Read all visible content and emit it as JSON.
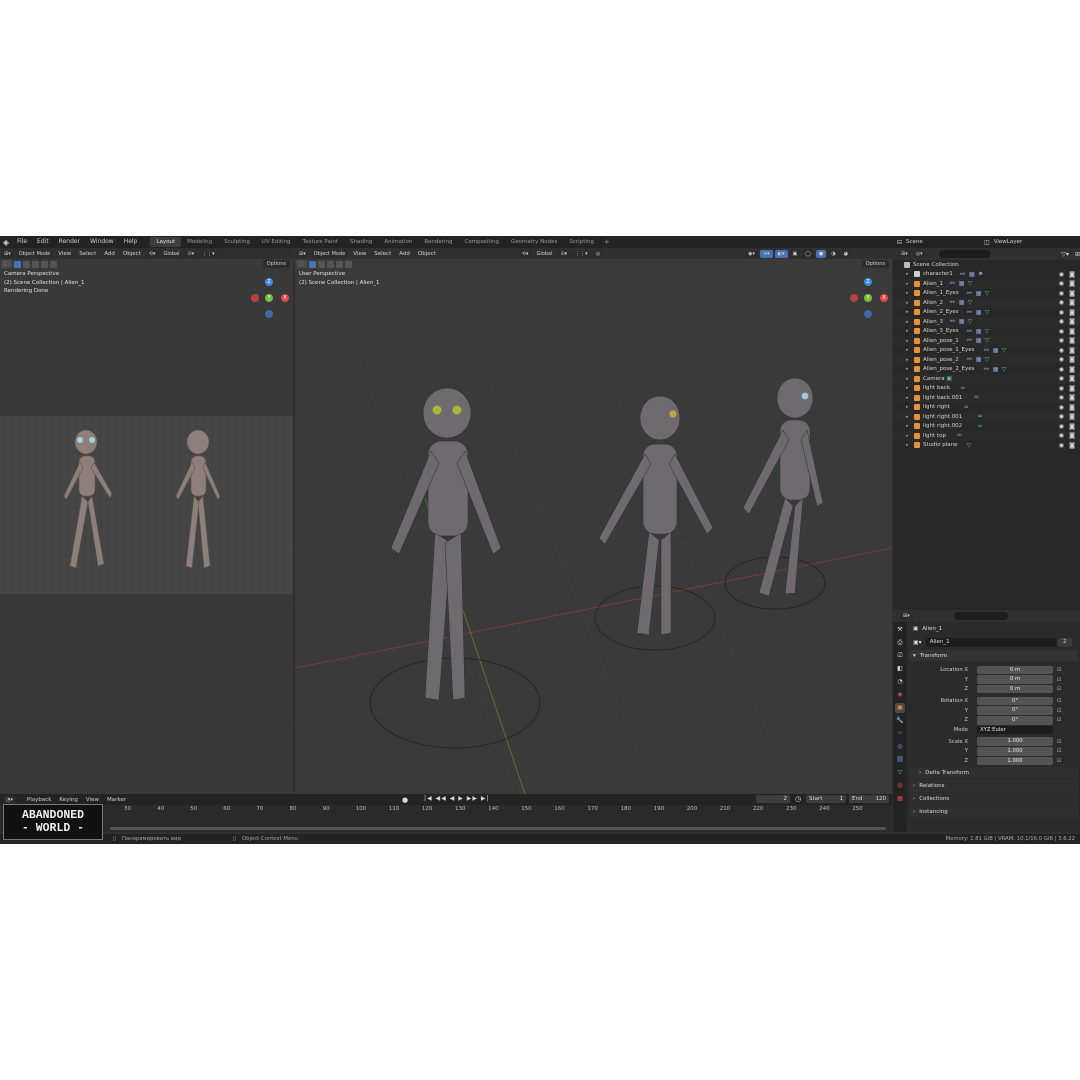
{
  "app": {
    "menu": [
      "File",
      "Edit",
      "Render",
      "Window",
      "Help"
    ],
    "workspaces": [
      "Layout",
      "Modeling",
      "Sculpting",
      "UV Editing",
      "Texture Paint",
      "Shading",
      "Animation",
      "Rendering",
      "Compositing",
      "Geometry Nodes",
      "Scripting"
    ],
    "active_workspace": "Layout",
    "add_tab": "+",
    "scene_label": "Scene",
    "view_layer_label": "ViewLayer"
  },
  "viewport_left": {
    "mode": "Object Mode",
    "menus": [
      "View",
      "Select",
      "Add",
      "Object"
    ],
    "orientation": "Global",
    "options": "Options",
    "info": [
      "Camera Perspective",
      "(2) Scene Collection | Alien_1",
      "Rendering Done"
    ]
  },
  "viewport_main": {
    "mode": "Object Mode",
    "menus": [
      "View",
      "Select",
      "Add",
      "Object"
    ],
    "orientation": "Global",
    "options": "Options",
    "info": [
      "User Perspective",
      "(2) Scene Collection | Alien_1"
    ]
  },
  "gizmo": {
    "x_label": "X",
    "y_label": "Y",
    "z_label": "Z"
  },
  "outliner": {
    "root": "Scene Collection",
    "items": [
      {
        "name": "character1",
        "icon": "collection-icon",
        "color": "#cfcfcf"
      },
      {
        "name": "Alien_1",
        "icon": "armature-icon",
        "color": "#e8913a"
      },
      {
        "name": "Alien_1_Eyes",
        "icon": "armature-icon",
        "color": "#e8913a"
      },
      {
        "name": "Alien_2",
        "icon": "armature-icon",
        "color": "#e8913a"
      },
      {
        "name": "Alien_2_Eyes",
        "icon": "armature-icon",
        "color": "#e8913a"
      },
      {
        "name": "Alien_3",
        "icon": "armature-icon",
        "color": "#e8913a"
      },
      {
        "name": "Alien_3_Eyes",
        "icon": "armature-icon",
        "color": "#e8913a"
      },
      {
        "name": "Alien_pose_1",
        "icon": "armature-icon",
        "color": "#e8913a"
      },
      {
        "name": "Alien_pose_1_Eyes",
        "icon": "armature-icon",
        "color": "#e8913a"
      },
      {
        "name": "Alien_pose_2",
        "icon": "armature-icon",
        "color": "#e8913a"
      },
      {
        "name": "Alien_pose_2_Eyes",
        "icon": "armature-icon",
        "color": "#e8913a"
      },
      {
        "name": "Camera",
        "icon": "camera-icon",
        "color": "#e8913a"
      },
      {
        "name": "light back",
        "icon": "light-icon",
        "color": "#e8913a"
      },
      {
        "name": "light back.001",
        "icon": "light-icon",
        "color": "#e8913a"
      },
      {
        "name": "light right",
        "icon": "light-icon",
        "color": "#e8913a"
      },
      {
        "name": "light right.001",
        "icon": "light-icon",
        "color": "#e8913a"
      },
      {
        "name": "light right.002",
        "icon": "light-icon",
        "color": "#e8913a"
      },
      {
        "name": "light top",
        "icon": "light-icon",
        "color": "#e8913a"
      },
      {
        "name": "Studio plane",
        "icon": "mesh-icon",
        "color": "#e8913a"
      }
    ]
  },
  "properties": {
    "object_name": "Alien_1",
    "data_name": "Alien_1",
    "users": "2",
    "transform_label": "Transform",
    "location": {
      "label": "Location X",
      "x": "0 m",
      "y": "0 m",
      "z": "0 m"
    },
    "rotation": {
      "label": "Rotation X",
      "x": "0°",
      "y": "0°",
      "z": "0°"
    },
    "mode_label": "Mode",
    "mode_value": "XYZ Euler",
    "scale": {
      "label": "Scale X",
      "x": "1.000",
      "y": "1.000",
      "z": "1.000"
    },
    "axis_y": "Y",
    "axis_z": "Z",
    "delta_transform": "Delta Transform",
    "relations": "Relations",
    "collections": "Collections",
    "instancing": "Instancing"
  },
  "timeline": {
    "menus": [
      "Playback",
      "Keying",
      "View",
      "Marker"
    ],
    "current_frame": "2",
    "start_label": "Start",
    "start": "1",
    "end_label": "End",
    "end": "120",
    "ticks": [
      "30",
      "40",
      "50",
      "60",
      "70",
      "80",
      "90",
      "100",
      "110",
      "120",
      "130",
      "140",
      "150",
      "160",
      "170",
      "180",
      "190",
      "200",
      "210",
      "220",
      "230",
      "240",
      "250"
    ]
  },
  "status": {
    "left": "Панорамировать вид",
    "middle": "Object Context Menu",
    "memory": "Memory: 1.81 GiB | VRAM: 10.1/16.0 GiB | 3.6.22"
  },
  "watermark": {
    "line1": "ABANDONED",
    "line2": "WORLD"
  },
  "colors": {
    "accent": "#4772b3",
    "orange": "#e8913a",
    "green": "#5fbf87",
    "x_axis": "#e04848",
    "y_axis": "#7cba3a",
    "z_axis": "#3d8be0"
  }
}
